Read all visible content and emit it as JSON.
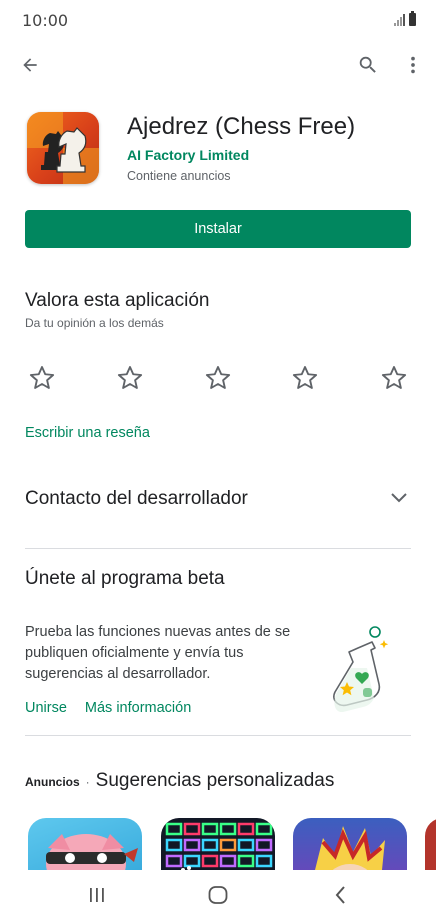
{
  "status": {
    "time": "10:00"
  },
  "app": {
    "title": "Ajedrez (Chess Free)",
    "developer": "AI Factory Limited",
    "ads_note": "Contiene anuncios",
    "install_label": "Instalar"
  },
  "rating": {
    "title": "Valora esta aplicación",
    "subtitle": "Da tu opinión a los demás",
    "stars": 5,
    "write_review": "Escribir una reseña"
  },
  "developer_contact": {
    "label": "Contacto del desarrollador"
  },
  "beta": {
    "title": "Únete al programa beta",
    "description": "Prueba las funciones nuevas antes de se publiquen oficialmente y envía tus sugerencias al desarrollador.",
    "join_label": "Unirse",
    "more_label": "Más información"
  },
  "suggestions": {
    "ads_label": "Anuncios",
    "separator": "·",
    "title": "Sugerencias personalizadas"
  },
  "colors": {
    "accent": "#01875f",
    "app_icon": "#e0501b"
  }
}
